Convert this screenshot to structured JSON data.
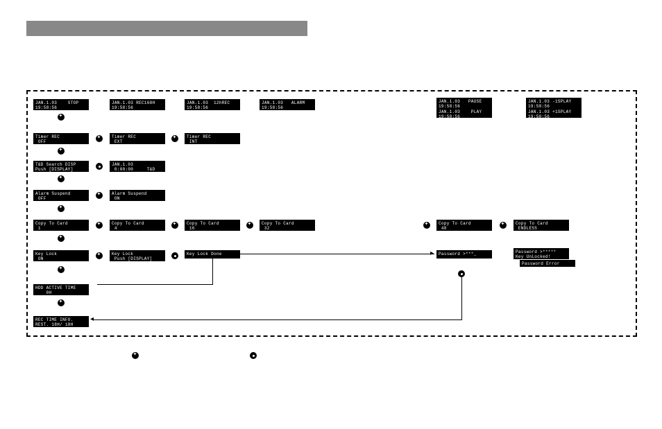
{
  "header_title": "",
  "row1": {
    "c1": "JAN.1.03    STOP\n19:58:56",
    "c2": "JAN.1.03 REC168H\n19:58:56",
    "c3": "JAN.1.03  12hREC\n19:58:56",
    "c4": "JAN.1.03   ALARM\n19:58:56",
    "c5": "JAN.1.03   PAUSE\n19:58:56",
    "c6": "JAN.1.03    PLAY\n19:58:56",
    "c7": "JAN.1.03 -1SPLAY\n19:58:56",
    "c8": "JAN.1.03 +1SPLAY\n19:58:56"
  },
  "row2": {
    "c1": "Timer REC\n OFF",
    "c2": "Timer REC\n EXT",
    "c3": "Timer REC\n INT"
  },
  "row3": {
    "c1": "T&D Search DISP\nPush [DISPLAY]",
    "c2": "JAN.1.03\n 0:00:00     T&D"
  },
  "row4": {
    "c1": "Alarm Suspend\n OFF",
    "c2": "Alarm Suspend\n ON"
  },
  "row5": {
    "c1": "Copy To Card\n 1",
    "c2": "Copy To Card\n 4",
    "c3": "Copy To Card\n 16",
    "c4": "Copy To Card\n 32",
    "c5": "Copy To Card\n 48",
    "c6": "Copy To Card\n ENDLESS"
  },
  "row6": {
    "c1": "Key Lock\n ON",
    "c2": "Key Lock\n Push [DISPLAY]",
    "c3": "Key Lock Done",
    "c4": "Password >***_",
    "c5": "Password >*****\nKey UnLocked!",
    "c6": "Password Error"
  },
  "row7": {
    "c1": "HDD ACTIVE TIME\n    0H"
  },
  "row8": {
    "c1": "REC TIME INFO.\nREST. 18H/ 18H"
  }
}
